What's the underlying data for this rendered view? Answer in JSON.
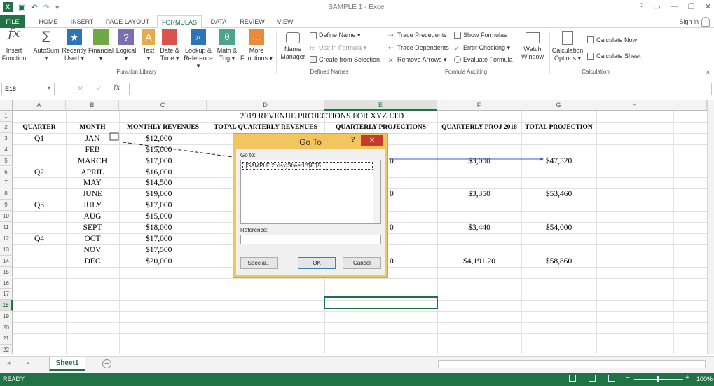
{
  "window": {
    "title": "SAMPLE 1 - Excel",
    "signin": "Sign in"
  },
  "tabs": [
    "FILE",
    "HOME",
    "INSERT",
    "PAGE LAYOUT",
    "FORMULAS",
    "DATA",
    "REVIEW",
    "VIEW"
  ],
  "active_tab": "FORMULAS",
  "ribbon": {
    "function_library": {
      "label": "Function Library",
      "buttons": [
        {
          "l1": "Insert",
          "l2": "Function"
        },
        {
          "l1": "AutoSum",
          "l2": "▾"
        },
        {
          "l1": "Recently",
          "l2": "Used ▾"
        },
        {
          "l1": "Financial",
          "l2": "▾"
        },
        {
          "l1": "Logical",
          "l2": "▾"
        },
        {
          "l1": "Text",
          "l2": "▾"
        },
        {
          "l1": "Date &",
          "l2": "Time ▾"
        },
        {
          "l1": "Lookup &",
          "l2": "Reference ▾"
        },
        {
          "l1": "Math &",
          "l2": "Trig ▾"
        },
        {
          "l1": "More",
          "l2": "Functions ▾"
        }
      ]
    },
    "defined_names": {
      "label": "Defined Names",
      "name_manager": {
        "l1": "Name",
        "l2": "Manager"
      },
      "define_name": "Define Name ▾",
      "use_in_formula": "Use in Formula ▾",
      "create_from_selection": "Create from Selection"
    },
    "formula_auditing": {
      "label": "Formula Auditing",
      "trace_precedents": "Trace Precedents",
      "trace_dependents": "Trace Dependents",
      "remove_arrows": "Remove Arrows ▾",
      "show_formulas": "Show Formulas",
      "error_checking": "Error Checking ▾",
      "evaluate_formula": "Evaluate Formula",
      "watch_window": {
        "l1": "Watch",
        "l2": "Window"
      }
    },
    "calculation": {
      "label": "Calculation",
      "options": {
        "l1": "Calculation",
        "l2": "Options ▾"
      },
      "calc_now": "Calculate Now",
      "calc_sheet": "Calculate Sheet"
    }
  },
  "formula_bar": {
    "name_box": "E18",
    "fx": "fx",
    "value": ""
  },
  "columns": [
    "A",
    "B",
    "C",
    "D",
    "E",
    "F",
    "G",
    "H"
  ],
  "rows": [
    "1",
    "2",
    "3",
    "4",
    "5",
    "6",
    "7",
    "8",
    "9",
    "10",
    "11",
    "12",
    "13",
    "14",
    "15",
    "16",
    "17",
    "18",
    "19",
    "20",
    "21",
    "22"
  ],
  "sheet": {
    "title": "2019 REVENUE PROJECTIONS FOR XYZ LTD",
    "headers": {
      "a": "QUARTER",
      "b": "MONTH",
      "c": "MONTHLY REVENUES",
      "d": "TOTAL QUARTERLY REVENUES",
      "e": "QUARTERLY PROJECTIONS",
      "f": "QUARTERLY PROJ 2018",
      "g": "TOTAL PROJECTION"
    },
    "quarters": [
      {
        "row": 3,
        "label": "Q1"
      },
      {
        "row": 6,
        "label": "Q2"
      },
      {
        "row": 9,
        "label": "Q3"
      },
      {
        "row": 12,
        "label": "Q4"
      }
    ],
    "months": [
      "JAN",
      "FEB",
      "MARCH",
      "APRIL",
      "MAY",
      "JUNE",
      "JULY",
      "AUG",
      "SEPT",
      "OCT",
      "NOV",
      "DEC"
    ],
    "revenues": [
      "$12,000",
      "$15,000",
      "$17,000",
      "$16,000",
      "$14,500",
      "$19,000",
      "$17,000",
      "$15,000",
      "$18,000",
      "$17,000",
      "$17,500",
      "$20,000"
    ],
    "proj_2018": [
      {
        "row": 5,
        "value": "$3,000"
      },
      {
        "row": 8,
        "value": "$3,350"
      },
      {
        "row": 11,
        "value": "$3,440"
      },
      {
        "row": 14,
        "value": "$4,191.20"
      }
    ],
    "total_proj": [
      {
        "row": 5,
        "value": "$47,520"
      },
      {
        "row": 8,
        "value": "$53,460"
      },
      {
        "row": 11,
        "value": "$54,000"
      },
      {
        "row": 14,
        "value": "$58,860"
      }
    ],
    "e_partial": "0"
  },
  "goto_dialog": {
    "title": "Go To",
    "help": "?",
    "close": "✕",
    "goto_label": "Go to:",
    "goto_item": "'[SAMPLE 2.xlsx]Sheet1'!$E$5",
    "reference_label": "Reference:",
    "reference_value": "",
    "special": "Special...",
    "ok": "OK",
    "cancel": "Cancel"
  },
  "sheet_tabs": [
    "Sheet1"
  ],
  "status": {
    "ready": "READY",
    "zoom": "100%"
  }
}
